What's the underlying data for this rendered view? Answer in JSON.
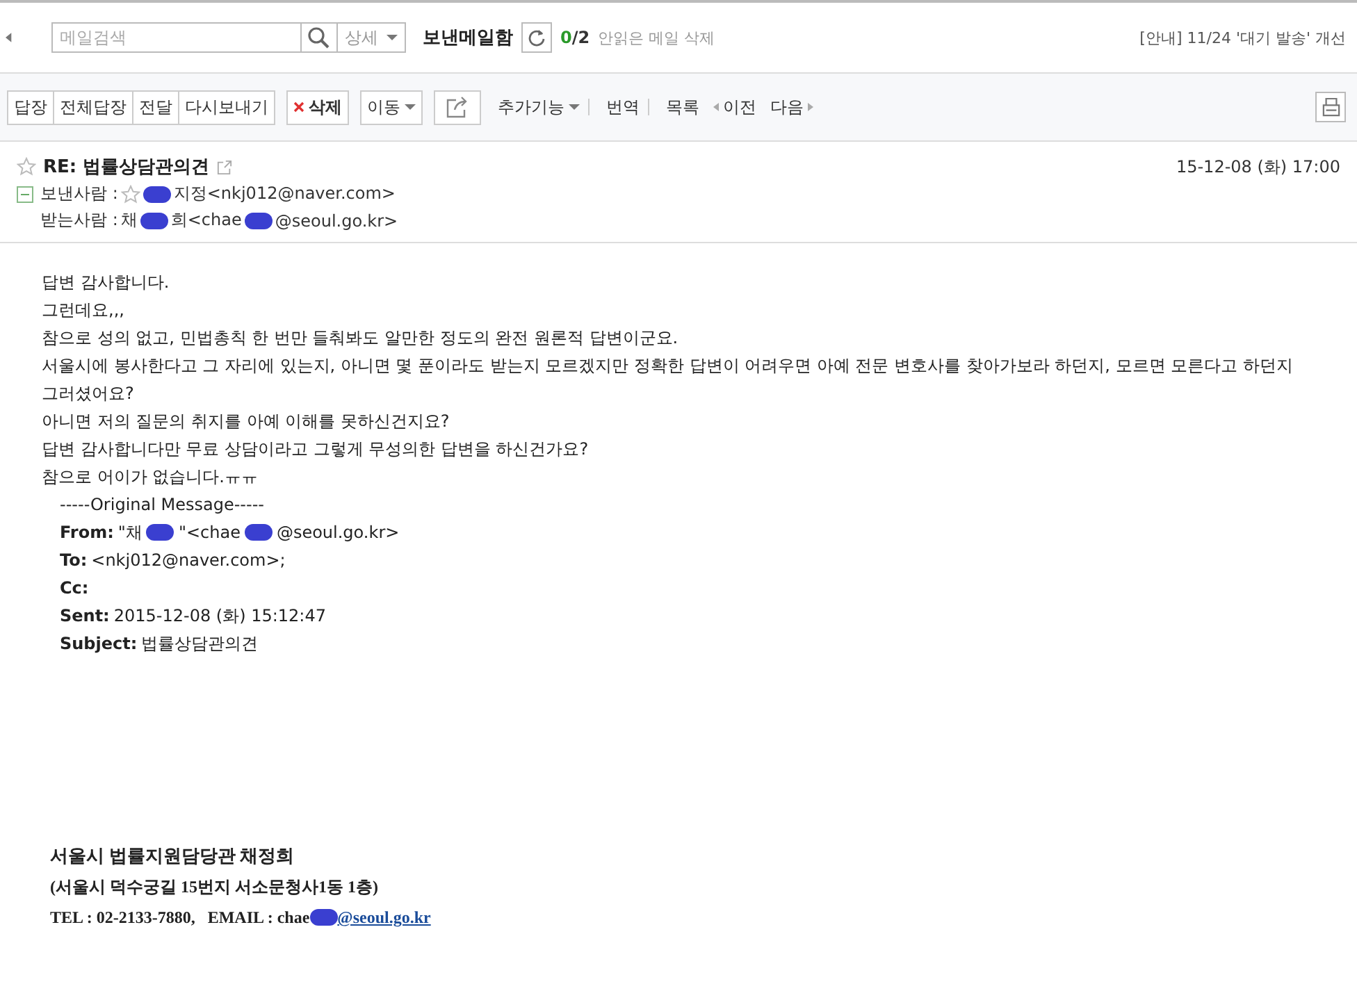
{
  "top_bar": {
    "search": {
      "placeholder": "메일검색"
    },
    "detail_dropdown": "상세",
    "folder": "보낸메일함",
    "unread": "0",
    "total": "/2",
    "delete_unread": "안읽은 메일 삭제",
    "notice": "[안내] 11/24 '대기 발송' 개선"
  },
  "toolbar": {
    "reply_group": [
      "답장",
      "전체답장",
      "전달",
      "다시보내기"
    ],
    "delete": "삭제",
    "move": "이동",
    "more": "추가기능",
    "links": [
      "번역",
      "목록"
    ],
    "prev": "이전",
    "next": "다음"
  },
  "header": {
    "starred": false,
    "subject": "RE: 법률상담관의견",
    "date": "15-12-08 (화) 17:00",
    "expanded": true,
    "sender_label": "보낸사람 :",
    "sender_starred": false,
    "sender": [
      {
        "kind": "redaction"
      },
      {
        "kind": "text",
        "text": "지정<nkj012@naver.com>"
      }
    ],
    "recipient_label": "받는사람 :",
    "recipient": [
      {
        "kind": "text",
        "text": "채"
      },
      {
        "kind": "redaction"
      },
      {
        "kind": "text",
        "text": "희<chae"
      },
      {
        "kind": "redaction"
      },
      {
        "kind": "text",
        "text": "@seoul.go.kr>"
      }
    ]
  },
  "body": {
    "lines": [
      "답변 감사합니다.",
      "그런데요,,,",
      "참으로 성의 없고, 민법총칙 한 번만 들춰봐도 알만한 정도의 완전 원론적 답변이군요.",
      "서울시에 봉사한다고 그 자리에 있는지, 아니면 몇 푼이라도 받는지 모르겠지만 정확한 답변이 어려우면 아예 전문 변호사를 찾아가보라 하던지, 모르면 모른다고 하던지",
      "그러셨어요?",
      "아니면 저의 질문의 취지를 아예 이해를 못하신건지요?",
      "답변 감사합니다만 무료 상담이라고 그렇게 무성의한 답변을 하신건가요?",
      "참으로 어이가 없습니다.ㅠㅠ"
    ],
    "original_header": "-----Original Message-----",
    "original_fields": [
      {
        "label": "From:",
        "value": [
          {
            "kind": "text",
            "text": "\"채"
          },
          {
            "kind": "redaction"
          },
          {
            "kind": "text",
            "text": "\"<chae"
          },
          {
            "kind": "redaction"
          },
          {
            "kind": "text",
            "text": "@seoul.go.kr>"
          }
        ]
      },
      {
        "label": "To:",
        "value": [
          {
            "kind": "text",
            "text": "<nkj012@naver.com>;"
          }
        ]
      },
      {
        "label": "Cc:"
      },
      {
        "label": "Sent:",
        "value": [
          {
            "kind": "text",
            "text": "2015-12-08 (화) 15:12:47"
          }
        ]
      },
      {
        "label": "Subject:",
        "value": [
          {
            "kind": "text",
            "text": "법률상담관의견"
          }
        ]
      }
    ]
  },
  "signature": {
    "name": "서울시 법률지원담당관 채정희",
    "address": "(서울시 덕수궁길 15번지 서소문청사1동 1층)",
    "contact": "TEL : 02-2133-7880,   EMAIL : chae",
    "email_domain": "@seoul.go.kr"
  }
}
